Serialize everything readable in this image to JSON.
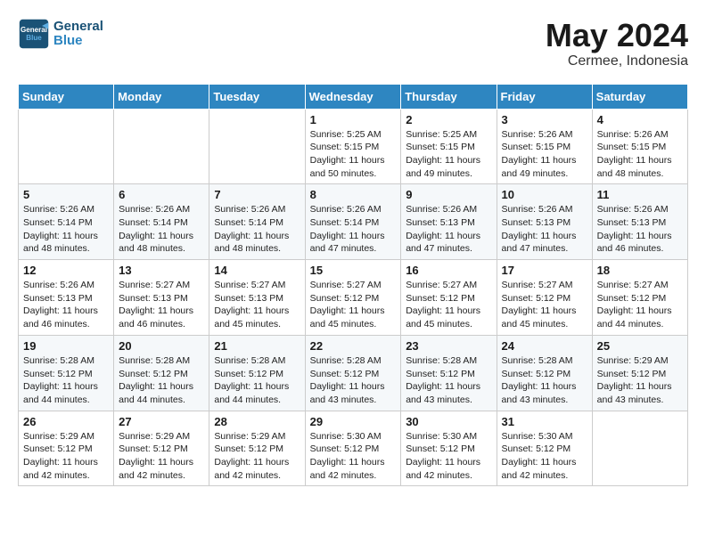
{
  "header": {
    "logo_line1": "General",
    "logo_line2": "Blue",
    "month_year": "May 2024",
    "location": "Cermee, Indonesia"
  },
  "days_of_week": [
    "Sunday",
    "Monday",
    "Tuesday",
    "Wednesday",
    "Thursday",
    "Friday",
    "Saturday"
  ],
  "weeks": [
    [
      {
        "day": "",
        "info": ""
      },
      {
        "day": "",
        "info": ""
      },
      {
        "day": "",
        "info": ""
      },
      {
        "day": "1",
        "info": "Sunrise: 5:25 AM\nSunset: 5:15 PM\nDaylight: 11 hours\nand 50 minutes."
      },
      {
        "day": "2",
        "info": "Sunrise: 5:25 AM\nSunset: 5:15 PM\nDaylight: 11 hours\nand 49 minutes."
      },
      {
        "day": "3",
        "info": "Sunrise: 5:26 AM\nSunset: 5:15 PM\nDaylight: 11 hours\nand 49 minutes."
      },
      {
        "day": "4",
        "info": "Sunrise: 5:26 AM\nSunset: 5:15 PM\nDaylight: 11 hours\nand 48 minutes."
      }
    ],
    [
      {
        "day": "5",
        "info": "Sunrise: 5:26 AM\nSunset: 5:14 PM\nDaylight: 11 hours\nand 48 minutes."
      },
      {
        "day": "6",
        "info": "Sunrise: 5:26 AM\nSunset: 5:14 PM\nDaylight: 11 hours\nand 48 minutes."
      },
      {
        "day": "7",
        "info": "Sunrise: 5:26 AM\nSunset: 5:14 PM\nDaylight: 11 hours\nand 48 minutes."
      },
      {
        "day": "8",
        "info": "Sunrise: 5:26 AM\nSunset: 5:14 PM\nDaylight: 11 hours\nand 47 minutes."
      },
      {
        "day": "9",
        "info": "Sunrise: 5:26 AM\nSunset: 5:13 PM\nDaylight: 11 hours\nand 47 minutes."
      },
      {
        "day": "10",
        "info": "Sunrise: 5:26 AM\nSunset: 5:13 PM\nDaylight: 11 hours\nand 47 minutes."
      },
      {
        "day": "11",
        "info": "Sunrise: 5:26 AM\nSunset: 5:13 PM\nDaylight: 11 hours\nand 46 minutes."
      }
    ],
    [
      {
        "day": "12",
        "info": "Sunrise: 5:26 AM\nSunset: 5:13 PM\nDaylight: 11 hours\nand 46 minutes."
      },
      {
        "day": "13",
        "info": "Sunrise: 5:27 AM\nSunset: 5:13 PM\nDaylight: 11 hours\nand 46 minutes."
      },
      {
        "day": "14",
        "info": "Sunrise: 5:27 AM\nSunset: 5:13 PM\nDaylight: 11 hours\nand 45 minutes."
      },
      {
        "day": "15",
        "info": "Sunrise: 5:27 AM\nSunset: 5:12 PM\nDaylight: 11 hours\nand 45 minutes."
      },
      {
        "day": "16",
        "info": "Sunrise: 5:27 AM\nSunset: 5:12 PM\nDaylight: 11 hours\nand 45 minutes."
      },
      {
        "day": "17",
        "info": "Sunrise: 5:27 AM\nSunset: 5:12 PM\nDaylight: 11 hours\nand 45 minutes."
      },
      {
        "day": "18",
        "info": "Sunrise: 5:27 AM\nSunset: 5:12 PM\nDaylight: 11 hours\nand 44 minutes."
      }
    ],
    [
      {
        "day": "19",
        "info": "Sunrise: 5:28 AM\nSunset: 5:12 PM\nDaylight: 11 hours\nand 44 minutes."
      },
      {
        "day": "20",
        "info": "Sunrise: 5:28 AM\nSunset: 5:12 PM\nDaylight: 11 hours\nand 44 minutes."
      },
      {
        "day": "21",
        "info": "Sunrise: 5:28 AM\nSunset: 5:12 PM\nDaylight: 11 hours\nand 44 minutes."
      },
      {
        "day": "22",
        "info": "Sunrise: 5:28 AM\nSunset: 5:12 PM\nDaylight: 11 hours\nand 43 minutes."
      },
      {
        "day": "23",
        "info": "Sunrise: 5:28 AM\nSunset: 5:12 PM\nDaylight: 11 hours\nand 43 minutes."
      },
      {
        "day": "24",
        "info": "Sunrise: 5:28 AM\nSunset: 5:12 PM\nDaylight: 11 hours\nand 43 minutes."
      },
      {
        "day": "25",
        "info": "Sunrise: 5:29 AM\nSunset: 5:12 PM\nDaylight: 11 hours\nand 43 minutes."
      }
    ],
    [
      {
        "day": "26",
        "info": "Sunrise: 5:29 AM\nSunset: 5:12 PM\nDaylight: 11 hours\nand 42 minutes."
      },
      {
        "day": "27",
        "info": "Sunrise: 5:29 AM\nSunset: 5:12 PM\nDaylight: 11 hours\nand 42 minutes."
      },
      {
        "day": "28",
        "info": "Sunrise: 5:29 AM\nSunset: 5:12 PM\nDaylight: 11 hours\nand 42 minutes."
      },
      {
        "day": "29",
        "info": "Sunrise: 5:30 AM\nSunset: 5:12 PM\nDaylight: 11 hours\nand 42 minutes."
      },
      {
        "day": "30",
        "info": "Sunrise: 5:30 AM\nSunset: 5:12 PM\nDaylight: 11 hours\nand 42 minutes."
      },
      {
        "day": "31",
        "info": "Sunrise: 5:30 AM\nSunset: 5:12 PM\nDaylight: 11 hours\nand 42 minutes."
      },
      {
        "day": "",
        "info": ""
      }
    ]
  ]
}
